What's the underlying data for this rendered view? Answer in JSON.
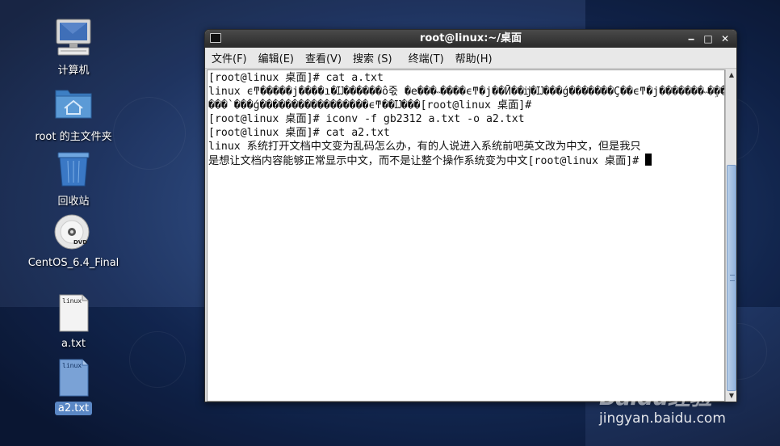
{
  "desktop": {
    "icons": [
      {
        "label": "计算机",
        "icon": "computer-icon"
      },
      {
        "label": "root 的主文件夹",
        "icon": "home-folder-icon"
      },
      {
        "label": "回收站",
        "icon": "trash-icon"
      },
      {
        "label": "CentOS_6.4_Final",
        "icon": "dvd-icon"
      },
      {
        "label": "a.txt",
        "icon": "text-file-icon",
        "badge": "linux"
      },
      {
        "label": "a2.txt",
        "icon": "text-file-icon",
        "badge": "linux"
      }
    ]
  },
  "window": {
    "title": "root@linux:~/桌面",
    "controls": {
      "minimize": "‒",
      "maximize": "□",
      "close": "✕"
    },
    "menu": [
      "文件(F)",
      "编辑(E)",
      "查看(V)",
      "搜索 (S)",
      "终端(T)",
      "帮助(H)"
    ]
  },
  "terminal": {
    "lines": [
      "[root@linux 桌面]# cat a.txt",
      "linux ϵͳ�����j����ı�Ĳ������ô죿 �е���˵����ϵͳ�j��Ӣ��ĳ�Ĳ���ǵ�������Ҫ��ϵͳ�j�������˵�ܹ���",
      "���`���ǵ�����������������ϵͳ��Ĳ���[root@linux 桌面]#",
      "[root@linux 桌面]# iconv -f gb2312 a.txt -o a2.txt",
      "[root@linux 桌面]# cat a2.txt",
      "linux 系统打开文档中文变为乱码怎么办，有的人说进入系统前吧英文改为中文，但是我只",
      "是想让文档内容能够正常显示中文，而不是让整个操作系统变为中文[root@linux 桌面]# "
    ]
  },
  "watermark": {
    "logo": "Baidu经验",
    "url": "jingyan.baidu.com"
  }
}
